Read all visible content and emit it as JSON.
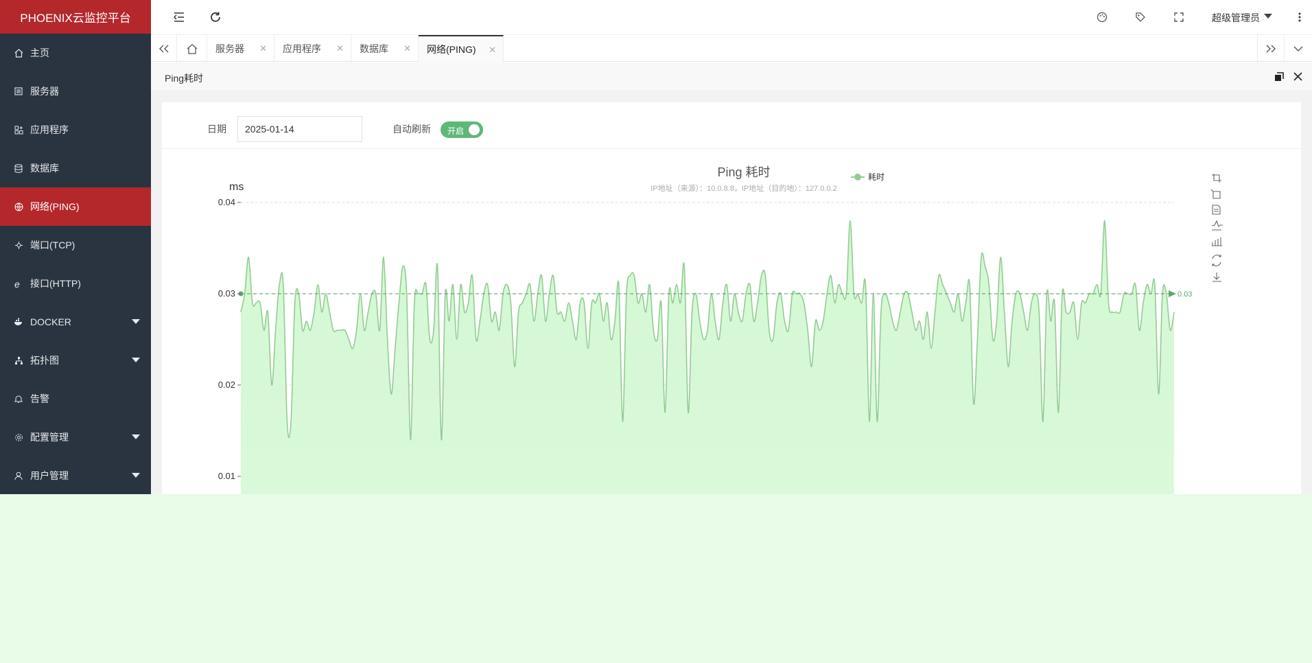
{
  "app": {
    "title": "PHOENIX云监控平台"
  },
  "sidebar": {
    "items": [
      {
        "label": "主页",
        "icon": "home-icon"
      },
      {
        "label": "服务器",
        "icon": "server-icon"
      },
      {
        "label": "应用程序",
        "icon": "app-icon"
      },
      {
        "label": "数据库",
        "icon": "database-icon"
      },
      {
        "label": "网络(PING)",
        "icon": "globe-icon",
        "active": true
      },
      {
        "label": "端口(TCP)",
        "icon": "port-icon"
      },
      {
        "label": "接口(HTTP)",
        "icon": "ie-icon"
      },
      {
        "label": "DOCKER",
        "icon": "docker-icon",
        "expandable": true
      },
      {
        "label": "拓扑图",
        "icon": "topology-icon",
        "expandable": true
      },
      {
        "label": "告警",
        "icon": "bell-icon"
      },
      {
        "label": "配置管理",
        "icon": "gear-icon",
        "expandable": true
      },
      {
        "label": "用户管理",
        "icon": "user-icon",
        "expandable": true
      }
    ]
  },
  "header": {
    "user": "超级管理员"
  },
  "tabs": [
    {
      "label": "服务器"
    },
    {
      "label": "应用程序"
    },
    {
      "label": "数据库"
    },
    {
      "label": "网络(PING)",
      "active": true
    }
  ],
  "panel": {
    "title": "Ping耗时"
  },
  "form": {
    "date_label": "日期",
    "date_value": "2025-01-14",
    "refresh_label": "自动刷新",
    "refresh_state": "开启"
  },
  "colors": {
    "accent": "#b4282c",
    "sidebar": "#2a3441",
    "series": "#93cc93",
    "area": "#d0f7d0",
    "switch": "#5fb878"
  },
  "chart_data": {
    "type": "area",
    "title": "Ping 耗时",
    "subtitle": "IP地址（来源）：10.0.8.8，IP地址（目的地）：127.0.0.2",
    "ylabel": "ms",
    "ylim": [
      0.01,
      0.04
    ],
    "yticks": [
      "0.04",
      "0.03",
      "0.02",
      "0.01"
    ],
    "legend": "top-center",
    "grid": true,
    "series": [
      {
        "name": "耗时",
        "markline_label": "0.03",
        "values": [
          0.028,
          0.03,
          0.034,
          0.029,
          0.029,
          0.029,
          0.026,
          0.028,
          0.02,
          0.026,
          0.031,
          0.031,
          0.016,
          0.016,
          0.029,
          0.03,
          0.026,
          0.027,
          0.026,
          0.028,
          0.031,
          0.028,
          0.03,
          0.028,
          0.026,
          0.026,
          0.026,
          0.026,
          0.025,
          0.024,
          0.026,
          0.03,
          0.026,
          0.028,
          0.03,
          0.03,
          0.026,
          0.034,
          0.025,
          0.019,
          0.024,
          0.029,
          0.033,
          0.03,
          0.014,
          0.029,
          0.03,
          0.03,
          0.031,
          0.025,
          0.026,
          0.033,
          0.014,
          0.03,
          0.027,
          0.031,
          0.025,
          0.031,
          0.028,
          0.029,
          0.032,
          0.025,
          0.027,
          0.03,
          0.031,
          0.027,
          0.028,
          0.026,
          0.03,
          0.031,
          0.029,
          0.022,
          0.028,
          0.029,
          0.03,
          0.031,
          0.027,
          0.03,
          0.032,
          0.027,
          0.03,
          0.032,
          0.028,
          0.028,
          0.027,
          0.029,
          0.027,
          0.025,
          0.029,
          0.029,
          0.024,
          0.029,
          0.029,
          0.03,
          0.027,
          0.029,
          0.025,
          0.027,
          0.031,
          0.016,
          0.03,
          0.032,
          0.032,
          0.029,
          0.03,
          0.028,
          0.031,
          0.026,
          0.025,
          0.029,
          0.017,
          0.03,
          0.029,
          0.031,
          0.029,
          0.033,
          0.017,
          0.028,
          0.03,
          0.027,
          0.025,
          0.026,
          0.03,
          0.027,
          0.025,
          0.029,
          0.031,
          0.027,
          0.03,
          0.028,
          0.027,
          0.03,
          0.031,
          0.027,
          0.029,
          0.032,
          0.032,
          0.026,
          0.025,
          0.029,
          0.03,
          0.027,
          0.026,
          0.03,
          0.03,
          0.03,
          0.029,
          0.026,
          0.022,
          0.027,
          0.026,
          0.027,
          0.03,
          0.032,
          0.029,
          0.031,
          0.03,
          0.03,
          0.038,
          0.03,
          0.03,
          0.029,
          0.031,
          0.016,
          0.03,
          0.016,
          0.028,
          0.03,
          0.029,
          0.027,
          0.026,
          0.028,
          0.03,
          0.03,
          0.028,
          0.026,
          0.027,
          0.025,
          0.028,
          0.024,
          0.028,
          0.032,
          0.031,
          0.03,
          0.029,
          0.028,
          0.03,
          0.027,
          0.029,
          0.031,
          0.018,
          0.025,
          0.034,
          0.033,
          0.031,
          0.025,
          0.027,
          0.034,
          0.028,
          0.022,
          0.027,
          0.03,
          0.03,
          0.028,
          0.026,
          0.029,
          0.03,
          0.028,
          0.016,
          0.03,
          0.027,
          0.029,
          0.017,
          0.03,
          0.028,
          0.028,
          0.029,
          0.025,
          0.029,
          0.029,
          0.03,
          0.03,
          0.031,
          0.03,
          0.038,
          0.029,
          0.028,
          0.028,
          0.028,
          0.03,
          0.03,
          0.03,
          0.031,
          0.026,
          0.029,
          0.031,
          0.03,
          0.031,
          0.019,
          0.03,
          0.03,
          0.026,
          0.028
        ]
      }
    ]
  }
}
